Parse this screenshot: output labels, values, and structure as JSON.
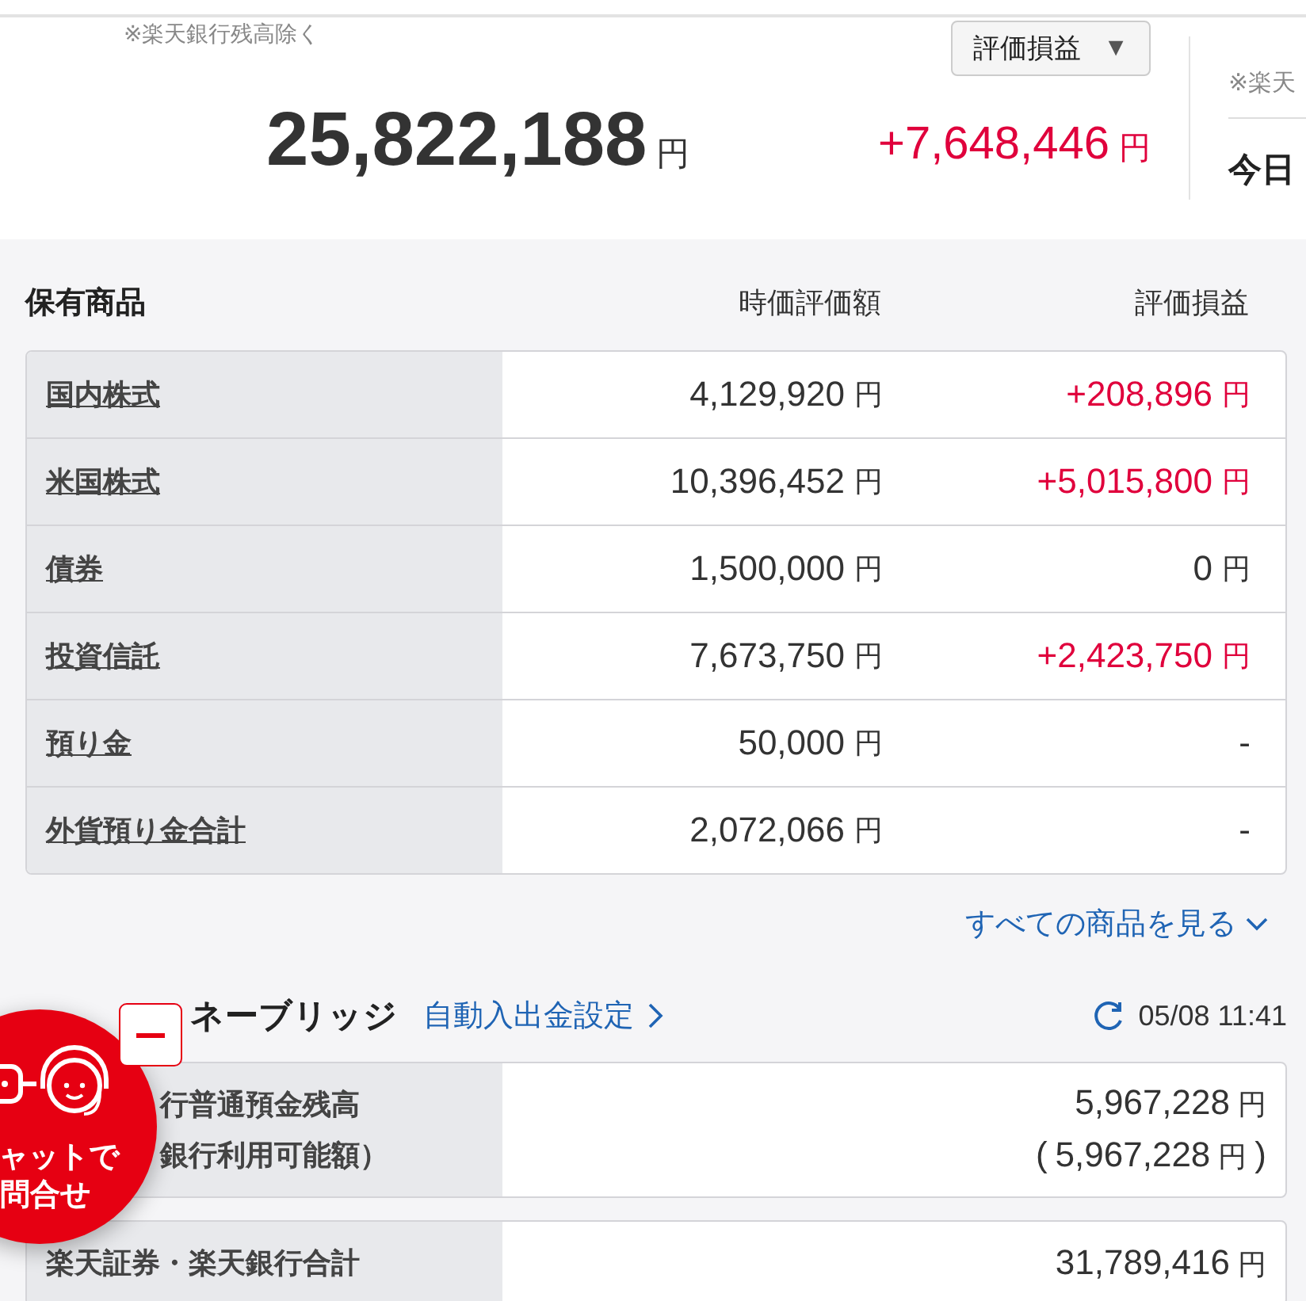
{
  "header": {
    "note": "※楽天銀行残高除く",
    "total": "25,822,188",
    "total_unit": "円",
    "dropdown": {
      "label": "評価損益",
      "arrow": "▼"
    },
    "gain": "+7,648,446",
    "gain_unit": "円"
  },
  "side_panel": {
    "note": "※楽天",
    "title": "今日"
  },
  "holdings": {
    "title": "保有商品",
    "columns": [
      "時価評価額",
      "評価損益"
    ],
    "rows": [
      {
        "name": "国内株式",
        "value": "4,129,920",
        "unit": "円",
        "gain": "+208,896",
        "gain_unit": "円",
        "color": "#e0003c"
      },
      {
        "name": "米国株式",
        "value": "10,396,452",
        "unit": "円",
        "gain": "+5,015,800",
        "gain_unit": "円",
        "color": "#e0003c"
      },
      {
        "name": "債券",
        "value": "1,500,000",
        "unit": "円",
        "gain": "0",
        "gain_unit": "円",
        "color": "#333333"
      },
      {
        "name": "投資信託",
        "value": "7,673,750",
        "unit": "円",
        "gain": "+2,423,750",
        "gain_unit": "円",
        "color": "#e0003c"
      },
      {
        "name": "預り金",
        "value": "50,000",
        "unit": "円",
        "gain": "-",
        "color": "#333333"
      },
      {
        "name": "外貨預り金合計",
        "value": "2,072,066",
        "unit": "円",
        "gain": "-",
        "color": "#333333"
      }
    ],
    "more_link": "すべての商品を見る"
  },
  "bridge": {
    "title": "ネーブリッジ",
    "link": "自動入出金設定",
    "updated": "05/08 11:41",
    "tables": [
      {
        "label_lines": [
          "行普通預金残高",
          "銀行利用可能額）"
        ],
        "amounts": [
          {
            "value": "5,967,228",
            "unit": "円"
          },
          {
            "open": "(",
            "value": "5,967,228",
            "unit": "円",
            "close": ")"
          }
        ]
      },
      {
        "label_lines": [
          "楽天証券・楽天銀行合計"
        ],
        "amounts": [
          {
            "value": "31,789,416",
            "unit": "円"
          }
        ]
      }
    ]
  },
  "chat": {
    "lines": [
      "ャットで",
      "問合せ"
    ]
  }
}
